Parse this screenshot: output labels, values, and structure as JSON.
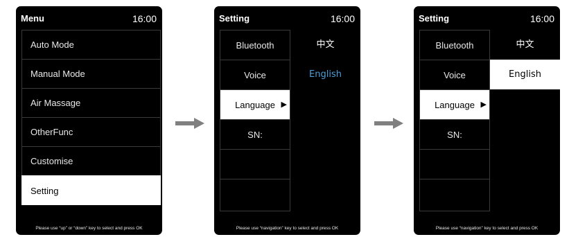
{
  "screens": [
    {
      "title": "Menu",
      "time": "16:00",
      "items": [
        "Auto Mode",
        "Manual Mode",
        "Air Massage",
        "OtherFunc",
        "Customise",
        "Setting"
      ],
      "footer": "Please use “up” or “down” key to select and press OK"
    },
    {
      "title": "Setting",
      "time": "16:00",
      "items": [
        "Bluetooth",
        "Voice",
        "Language",
        "SN:",
        "",
        ""
      ],
      "languages": [
        "中文",
        "English"
      ],
      "footer": "Please use “navigation” key to select and press OK"
    },
    {
      "title": "Setting",
      "time": "16:00",
      "items": [
        "Bluetooth",
        "Voice",
        "Language",
        "SN:",
        "",
        ""
      ],
      "languages": [
        "中文",
        "English"
      ],
      "footer": "Please use “navigation” key to select and press OK"
    }
  ],
  "colors": {
    "screen_bg": "#000000",
    "highlight_text": "#4a9fd8",
    "arrow": "#808080",
    "selected_bg": "#ffffff"
  },
  "icons": {
    "pointer": "▶",
    "transition": "right-arrow-icon"
  }
}
